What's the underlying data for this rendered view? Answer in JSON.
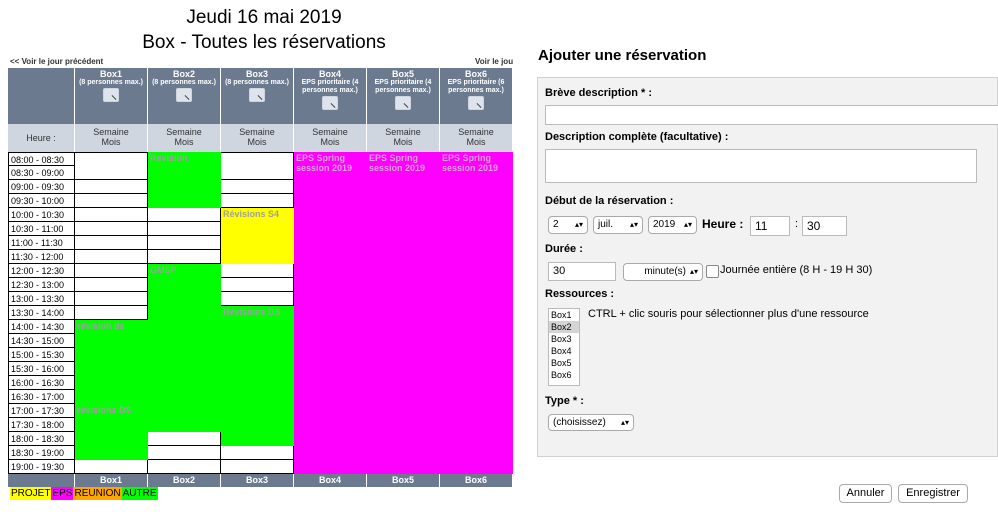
{
  "day_view": {
    "date_title": "Jeudi 16 mai 2019",
    "area_title": "Box - Toutes les réservations",
    "prev_link": "<< Voir le jour précédent",
    "next_link": "Voir le jou",
    "time_header": "Heure :",
    "week_label": "Semaine",
    "month_label": "Mois",
    "rooms": [
      {
        "name": "Box1",
        "desc": "(8 personnes max.)"
      },
      {
        "name": "Box2",
        "desc": "(8 personnes max.)"
      },
      {
        "name": "Box3",
        "desc": "(8 personnes max.)"
      },
      {
        "name": "Box4",
        "desc": "EPS prioritaire (4 personnes max.)"
      },
      {
        "name": "Box5",
        "desc": "EPS prioritaire (4 personnes max.)"
      },
      {
        "name": "Box6",
        "desc": "EPS prioritaire (6 personnes max.)"
      }
    ],
    "slots": [
      "08:00 - 08:30",
      "08:30 - 09:00",
      "09:00 - 09:30",
      "09:30 - 10:00",
      "10:00 - 10:30",
      "10:30 - 11:00",
      "11:00 - 11:30",
      "11:30 - 12:00",
      "12:00 - 12:30",
      "12:30 - 13:00",
      "13:00 - 13:30",
      "13:30 - 14:00",
      "14:00 - 14:30",
      "14:30 - 15:00",
      "15:00 - 15:30",
      "15:30 - 16:00",
      "16:00 - 16:30",
      "16:30 - 17:00",
      "17:00 - 17:30",
      "17:30 - 18:00",
      "18:00 - 18:30",
      "18:30 - 19:00",
      "19:00 - 19:30"
    ],
    "reservations": [
      {
        "room": 1,
        "start": 0,
        "span": 4,
        "label": "Revision",
        "color": "#00ff00"
      },
      {
        "room": 2,
        "start": 4,
        "span": 4,
        "label": "Révisions S4",
        "color": "#ffff00"
      },
      {
        "room": 1,
        "start": 8,
        "span": 12,
        "label": "GMSP",
        "color": "#00ff00"
      },
      {
        "room": 2,
        "start": 11,
        "span": 10,
        "label": "Révisions DS",
        "color": "#00ff00"
      },
      {
        "room": 0,
        "start": 12,
        "span": 6,
        "label": "révision ds",
        "color": "#00ff00"
      },
      {
        "room": 0,
        "start": 18,
        "span": 4,
        "label": "révisions DS",
        "color": "#00ff00"
      },
      {
        "room": 3,
        "start": 0,
        "span": 23,
        "label": "EPS Spring session 2019",
        "color": "#ff00ff"
      },
      {
        "room": 4,
        "start": 0,
        "span": 23,
        "label": "EPS Spring session 2019",
        "color": "#ff00ff"
      },
      {
        "room": 5,
        "start": 0,
        "span": 23,
        "label": "EPS Spring session 2019",
        "color": "#ff00ff"
      }
    ],
    "legend": [
      {
        "label": "PROJET",
        "color": "#ffff00"
      },
      {
        "label": "EPS",
        "color": "#ff00ff"
      },
      {
        "label": "REUNION",
        "color": "#ffa500"
      },
      {
        "label": "AUTRE",
        "color": "#00ff00"
      }
    ]
  },
  "form": {
    "title": "Ajouter une réservation",
    "brief_label": "Brève description * :",
    "brief_value": "",
    "full_label": "Description complète (facultative) :",
    "full_value": "",
    "start_label": "Début de la réservation :",
    "day_value": "2",
    "month_value": "juil.",
    "year_value": "2019",
    "hour_label": "Heure :",
    "hour_value": "11",
    "colon": ":",
    "minute_value": "30",
    "duration_label": "Durée :",
    "duration_value": "30",
    "duration_unit": "minute(s)",
    "allday_label": "Journée entière (8 H - 19 H 30)",
    "resources_label": "Ressources :",
    "resources_hint": "CTRL + clic souris pour sélectionner plus d'une ressource",
    "resources": [
      "Box1",
      "Box2",
      "Box3",
      "Box4",
      "Box5",
      "Box6"
    ],
    "resources_selected": "Box2",
    "type_label": "Type * :",
    "type_value": "(choisissez)",
    "cancel_label": "Annuler",
    "save_label": "Enregistrer"
  }
}
